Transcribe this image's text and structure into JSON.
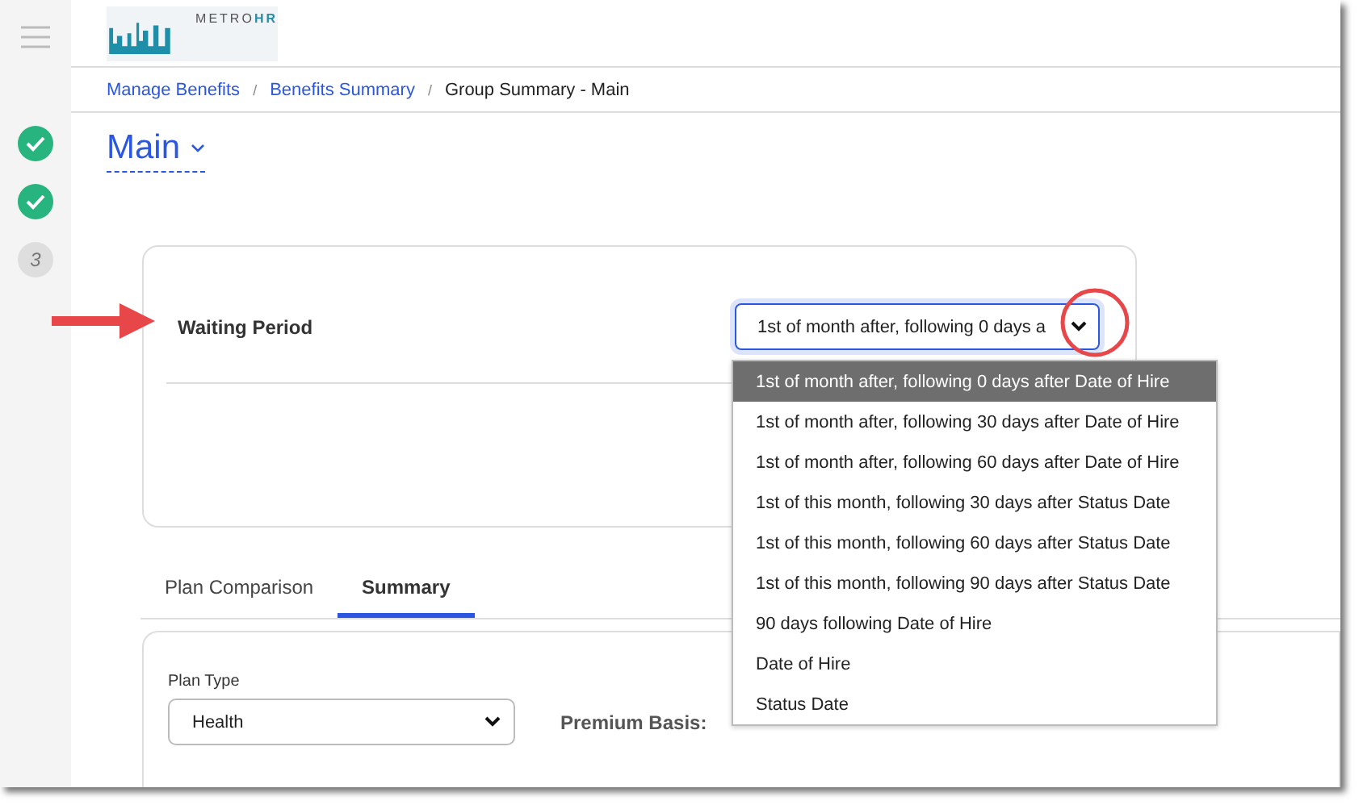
{
  "logo": {
    "text_left": "METRO",
    "text_right": "HR"
  },
  "steps": [
    {
      "completed": true
    },
    {
      "completed": true
    },
    {
      "completed": false,
      "label": "3"
    }
  ],
  "breadcrumb_separators": [
    "/",
    "/"
  ],
  "breadcrumb": [
    {
      "label": "Manage Benefits",
      "link": true
    },
    {
      "label": "Benefits Summary",
      "link": true
    },
    {
      "label": "Group Summary - Main",
      "link": false
    }
  ],
  "page_title": "Main",
  "waiting_period": {
    "label": "Waiting Period",
    "value": "1st of month after, following 0 days a",
    "options": [
      {
        "label": "1st of month after, following 0 days after Date of Hire",
        "selected": true
      },
      {
        "label": "1st of month after, following 30 days after Date of Hire",
        "selected": false
      },
      {
        "label": "1st of month after, following 60 days after Date of Hire",
        "selected": false
      },
      {
        "label": "1st of this month, following 30 days after Status Date",
        "selected": false
      },
      {
        "label": "1st of this month, following 60 days after Status Date",
        "selected": false
      },
      {
        "label": "1st of this month, following 90 days after Status Date",
        "selected": false
      },
      {
        "label": "90 days following Date of Hire",
        "selected": false
      },
      {
        "label": "Date of Hire",
        "selected": false
      },
      {
        "label": "Status Date",
        "selected": false
      }
    ]
  },
  "tabs": [
    {
      "label": "Plan Comparison",
      "selected": false
    },
    {
      "label": "Summary",
      "selected": true
    }
  ],
  "plan_type": {
    "label": "Plan Type",
    "value": "Health"
  },
  "premium_basis": "Premium Basis:"
}
